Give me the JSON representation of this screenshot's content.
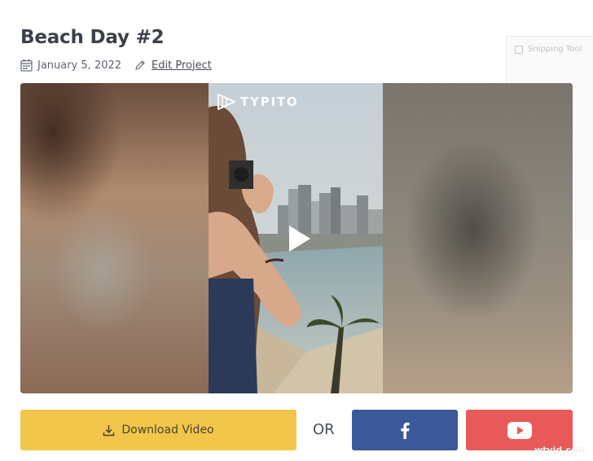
{
  "project": {
    "title": "Beach Day #2",
    "date": "January 5, 2022",
    "edit_label": "Edit Project"
  },
  "overlay": {
    "label": "Snipping Tool"
  },
  "video": {
    "brand": "TYPITO"
  },
  "actions": {
    "download_label": "Download Video",
    "or_label": "OR",
    "facebook_icon": "facebook-f-icon",
    "youtube_icon": "youtube-play-icon"
  },
  "watermark": "wtvid.com",
  "colors": {
    "download": "#f2c64b",
    "facebook": "#3b5998",
    "youtube": "#e85a5a"
  }
}
